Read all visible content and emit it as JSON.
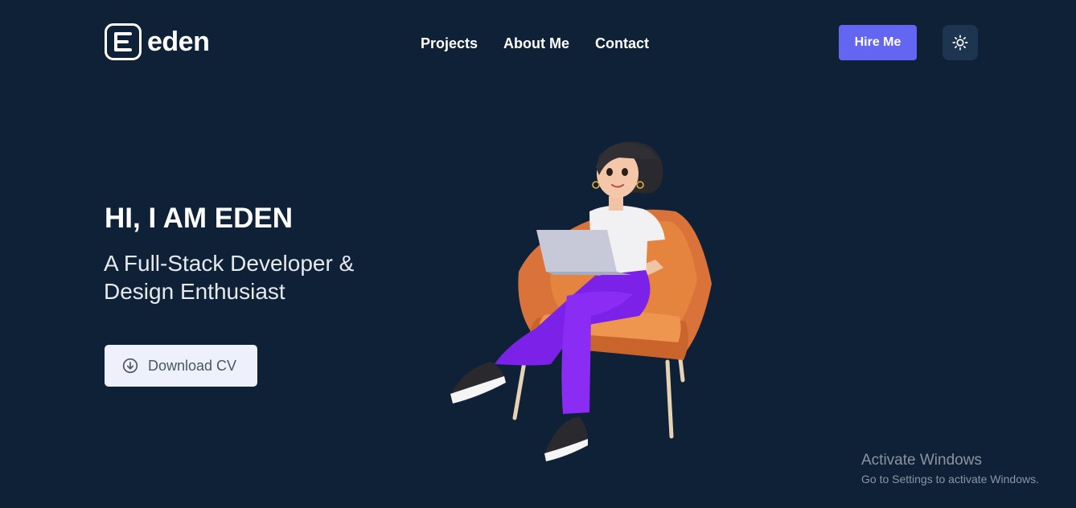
{
  "brand": {
    "name": "eden"
  },
  "nav": {
    "items": [
      {
        "label": "Projects"
      },
      {
        "label": "About Me"
      },
      {
        "label": "Contact"
      }
    ]
  },
  "header": {
    "hire_label": "Hire Me",
    "theme_icon": "sun-icon"
  },
  "hero": {
    "title": "HI, I AM EDEN",
    "subtitle": "A Full-Stack Developer & Design Enthusiast",
    "cv_label": "Download CV",
    "cv_icon": "download-circle-icon"
  },
  "watermark": {
    "line1": "Activate Windows",
    "line2": "Go to Settings to activate Windows."
  },
  "colors": {
    "background": "#0f2137",
    "accent": "#6366f1",
    "theme_button_bg": "#1e3552",
    "cv_button_bg": "#eef1fb"
  }
}
